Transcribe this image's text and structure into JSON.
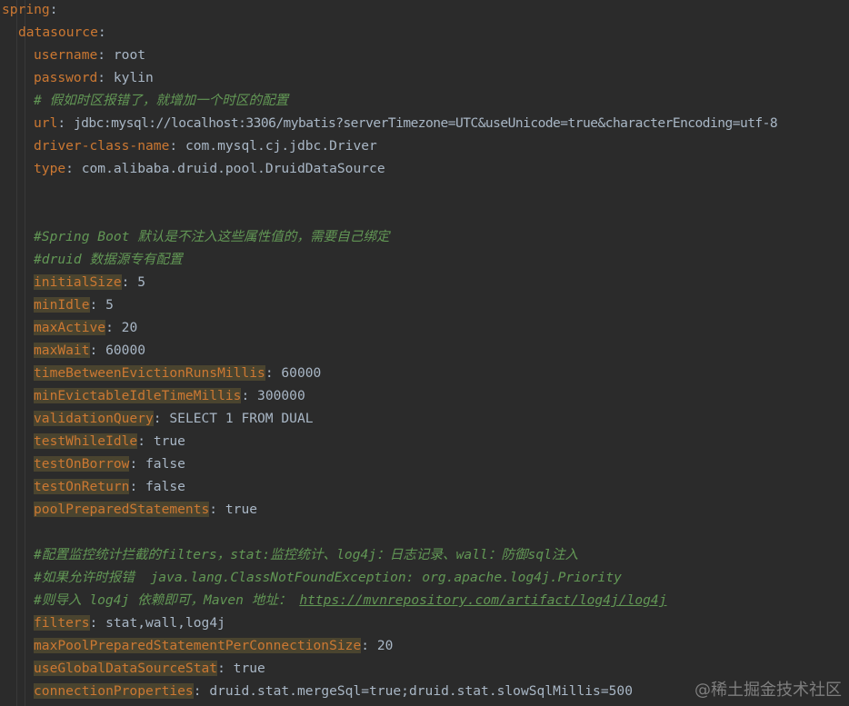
{
  "editor": {
    "lines": {
      "l1": {
        "key": "spring",
        "sep": ":"
      },
      "l2": {
        "key": "datasource",
        "sep": ":"
      },
      "l3": {
        "key": "username",
        "sep": ": ",
        "value": "root"
      },
      "l4": {
        "key": "password",
        "sep": ": ",
        "value": "kylin"
      },
      "l5": {
        "comment": "# 假如时区报错了，就增加一个时区的配置"
      },
      "l6": {
        "key": "url",
        "sep": ": ",
        "value": "jdbc:mysql://localhost:3306/mybatis?serverTimezone=UTC&useUnicode=true&characterEncoding=utf-8"
      },
      "l7": {
        "key": "driver-class-name",
        "sep": ": ",
        "value": "com.mysql.cj.jdbc.Driver"
      },
      "l8": {
        "key": "type",
        "sep": ": ",
        "value": "com.alibaba.druid.pool.DruidDataSource"
      },
      "l11": {
        "comment": "#Spring Boot 默认是不注入这些属性值的，需要自己绑定"
      },
      "l12": {
        "comment": "#druid 数据源专有配置"
      },
      "l13": {
        "key": "initialSize",
        "sep": ": ",
        "value": "5"
      },
      "l14": {
        "key": "minIdle",
        "sep": ": ",
        "value": "5"
      },
      "l15": {
        "key": "maxActive",
        "sep": ": ",
        "value": "20"
      },
      "l16": {
        "key": "maxWait",
        "sep": ": ",
        "value": "60000"
      },
      "l17": {
        "key": "timeBetweenEvictionRunsMillis",
        "sep": ": ",
        "value": "60000"
      },
      "l18": {
        "key": "minEvictableIdleTimeMillis",
        "sep": ": ",
        "value": "300000"
      },
      "l19": {
        "key": "validationQuery",
        "sep": ": ",
        "value": "SELECT 1 FROM DUAL"
      },
      "l20": {
        "key": "testWhileIdle",
        "sep": ": ",
        "value": "true"
      },
      "l21": {
        "key": "testOnBorrow",
        "sep": ": ",
        "value": "false"
      },
      "l22": {
        "key": "testOnReturn",
        "sep": ": ",
        "value": "false"
      },
      "l23": {
        "key": "poolPreparedStatements",
        "sep": ": ",
        "value": "true"
      },
      "l25": {
        "comment": "#配置监控统计拦截的filters，stat:监控统计、log4j：日志记录、wall：防御sql注入"
      },
      "l26": {
        "comment": "#如果允许时报错  java.lang.ClassNotFoundException: org.apache.log4j.Priority"
      },
      "l27": {
        "comment": "#则导入 log4j 依赖即可，Maven 地址： ",
        "link": "https://mvnrepository.com/artifact/log4j/log4j"
      },
      "l28": {
        "key": "filters",
        "sep": ": ",
        "value": "stat,wall,log4j"
      },
      "l29": {
        "key": "maxPoolPreparedStatementPerConnectionSize",
        "sep": ": ",
        "value": "20"
      },
      "l30": {
        "key": "useGlobalDataSourceStat",
        "sep": ": ",
        "value": "true"
      },
      "l31": {
        "key": "connectionProperties",
        "sep": ": ",
        "value": "druid.stat.mergeSql=true;druid.stat.slowSqlMillis=500"
      }
    }
  },
  "watermark": "@稀土掘金技术社区",
  "colors": {
    "background": "#2b2b2b",
    "key": "#cc7832",
    "value": "#a9b7c6",
    "comment": "#629755",
    "highlight": "#4a442f"
  }
}
